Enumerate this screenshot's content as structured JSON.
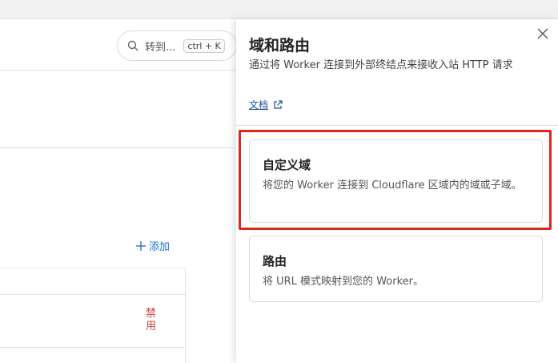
{
  "search": {
    "placeholder": "转到...",
    "shortcut": "ctrl + K"
  },
  "background": {
    "add_label": "添加",
    "status_text": "禁用"
  },
  "panel": {
    "title": "域和路由",
    "description": "通过将 Worker 连接到外部终结点来接收入站 HTTP 请求",
    "docs_label": "文档",
    "options": [
      {
        "title": "自定义域",
        "description": "将您的 Worker 连接到 Cloudflare 区域内的域或子域。"
      },
      {
        "title": "路由",
        "description": "将 URL 模式映射到您的 Worker。"
      }
    ]
  },
  "colors": {
    "accent": "#1d6fd1",
    "highlight": "#e0251b",
    "danger": "#d03c3c"
  }
}
